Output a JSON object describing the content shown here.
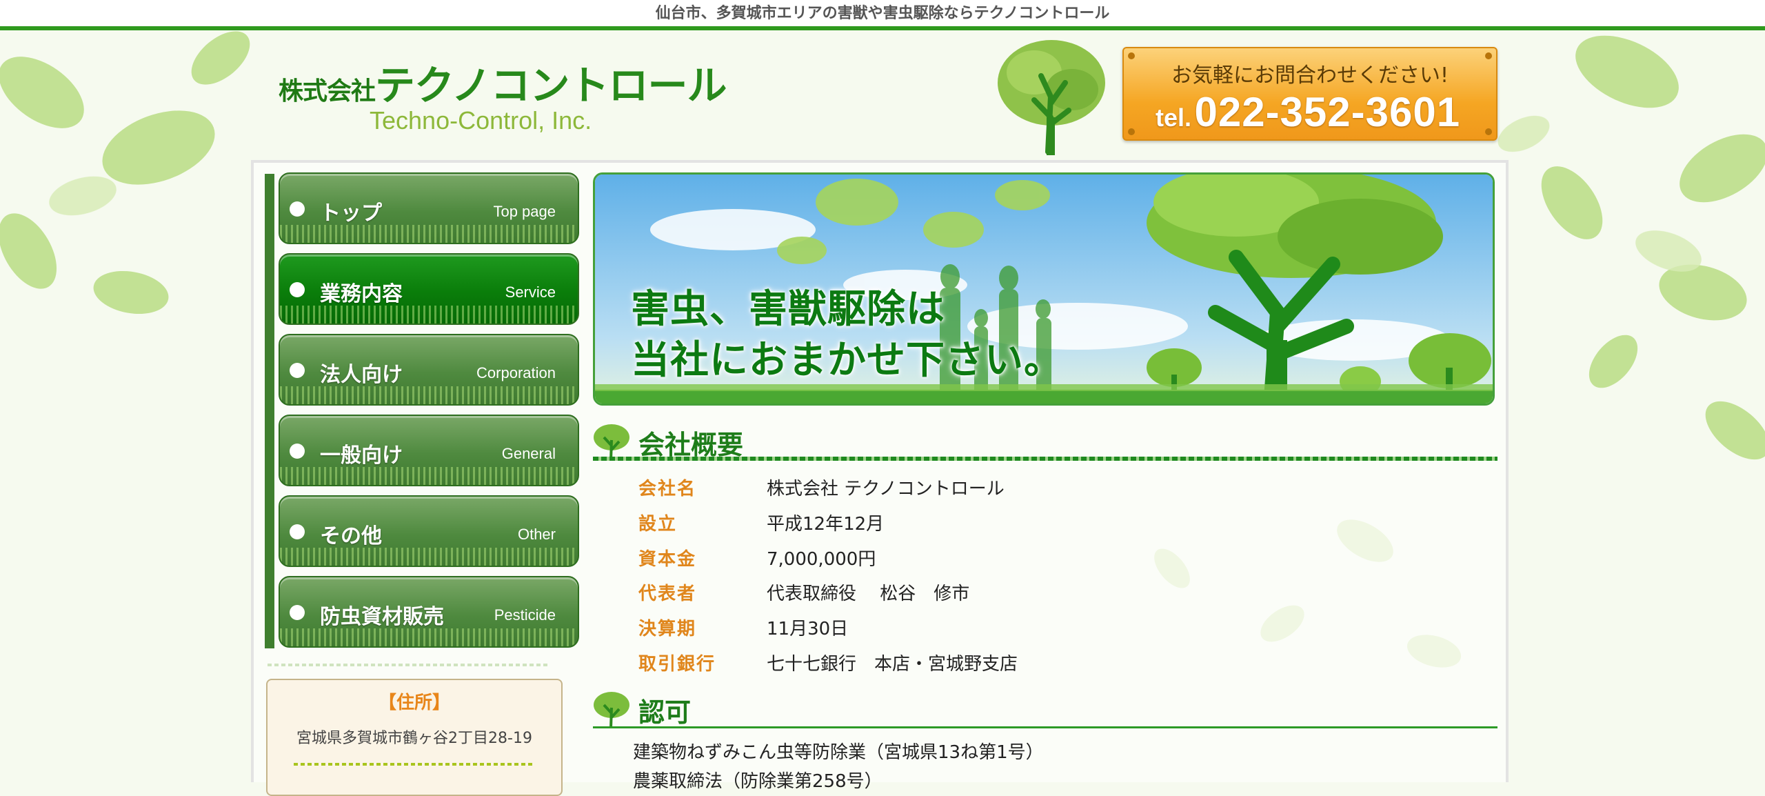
{
  "site": {
    "tagline": "仙台市、多賀城市エリアの害獣や害虫駆除ならテクノコントロール"
  },
  "logo": {
    "prefix": "株式会社",
    "name": "テクノコントロール",
    "english": "Techno-Control, Inc."
  },
  "contact": {
    "message": "お気軽にお問合わせください!",
    "tel_prefix": "tel.",
    "tel": "022-352-3601"
  },
  "nav": {
    "items": [
      {
        "jp": "トップ",
        "en": "Top page",
        "active": false
      },
      {
        "jp": "業務内容",
        "en": "Service",
        "active": true
      },
      {
        "jp": "法人向け",
        "en": "Corporation",
        "active": false
      },
      {
        "jp": "一般向け",
        "en": "General",
        "active": false
      },
      {
        "jp": "その他",
        "en": "Other",
        "active": false
      },
      {
        "jp": "防虫資材販売",
        "en": "Pesticide",
        "active": false
      }
    ]
  },
  "address": {
    "title": "【住所】",
    "text": "宮城県多賀城市鶴ヶ谷2丁目28-19"
  },
  "banner": {
    "line1": "害虫、害獣駆除は",
    "line2": "当社におまかせ下さい。"
  },
  "company": {
    "title": "会社概要",
    "rows": [
      {
        "label": "会社名",
        "value": "株式会社 テクノコントロール"
      },
      {
        "label": "設立",
        "value": "平成12年12月"
      },
      {
        "label": "資本金",
        "value": "7,000,000円"
      },
      {
        "label": "代表者",
        "value": "代表取締役　 松谷　修市"
      },
      {
        "label": "決算期",
        "value": "11月30日"
      },
      {
        "label": "取引銀行",
        "value": "七十七銀行　本店・宮城野支店"
      }
    ]
  },
  "permit": {
    "title": "認可",
    "lines": [
      "建築物ねずみこん虫等防除業（宮城県13ね第1号）",
      "農薬取締法（防除業第258号）"
    ]
  },
  "colors": {
    "brand_green": "#27891b",
    "accent_orange": "#e0861c",
    "contact_orange": "#f5a623",
    "nav_active": "#0a7d0a"
  }
}
